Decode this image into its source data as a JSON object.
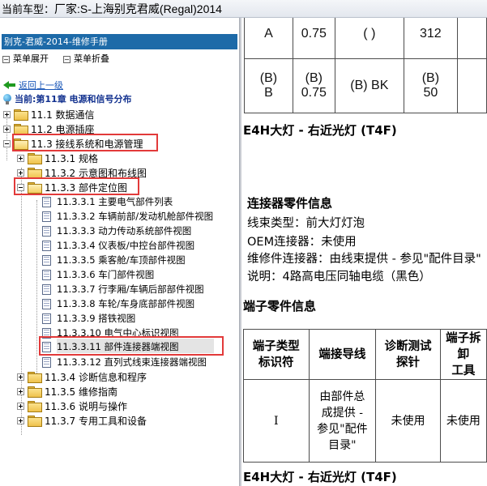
{
  "title_bar": {
    "label": "当前车型：",
    "value": "厂家:S-上海别克君威(Regal)2014"
  },
  "left_pane": {
    "header": "别克-君威-2014-维修手册",
    "toolbar": {
      "expand_label": "菜单展开",
      "collapse_label": "菜单折叠"
    },
    "back_link": "返回上一级",
    "current_chapter": "当前:第11章 电源和信号分布",
    "tree": [
      {
        "label": "11.1 数据通信",
        "level": 0,
        "expanded": false
      },
      {
        "label": "11.2 电源插座",
        "level": 0,
        "expanded": false
      },
      {
        "label": "11.3 接线系统和电源管理",
        "level": 0,
        "expanded": true,
        "highlighted": true
      },
      {
        "label": "11.3.1 规格",
        "level": 1,
        "expanded": false
      },
      {
        "label": "11.3.2 示意图和布线图",
        "level": 1,
        "expanded": false
      },
      {
        "label": "11.3.3 部件定位图",
        "level": 1,
        "expanded": true,
        "highlighted": true
      },
      {
        "label": "11.3.3.1 主要电气部件列表",
        "level": 2
      },
      {
        "label": "11.3.3.2 车辆前部/发动机舱部件视图",
        "level": 2
      },
      {
        "label": "11.3.3.3 动力传动系统部件视图",
        "level": 2
      },
      {
        "label": "11.3.3.4 仪表板/中控台部件视图",
        "level": 2
      },
      {
        "label": "11.3.3.5 乘客舱/车顶部件视图",
        "level": 2
      },
      {
        "label": "11.3.3.6 车门部件视图",
        "level": 2
      },
      {
        "label": "11.3.3.7 行李厢/车辆后部部件视图",
        "level": 2
      },
      {
        "label": "11.3.3.8 车轮/车身底部部件视图",
        "level": 2
      },
      {
        "label": "11.3.3.9 搭铁视图",
        "level": 2
      },
      {
        "label": "11.3.3.10 电气中心标识视图",
        "level": 2
      },
      {
        "label": "11.3.3.11 部件连接器端视图",
        "level": 2,
        "selected": true,
        "highlighted": true
      },
      {
        "label": "11.3.3.12 直列式线束连接器端视图",
        "level": 2
      },
      {
        "label": "11.3.4 诊断信息和程序",
        "level": 1,
        "expanded": false
      },
      {
        "label": "11.3.5 维修指南",
        "level": 1,
        "expanded": false
      },
      {
        "label": "11.3.6 说明与操作",
        "level": 1,
        "expanded": false
      },
      {
        "label": "11.3.7 专用工具和设备",
        "level": 1,
        "expanded": false
      }
    ]
  },
  "right_pane": {
    "top_table": {
      "rows": [
        [
          "A",
          "0.75",
          "(  )",
          "312"
        ],
        [
          "(B)\nB",
          "(B)\n0.75",
          "(B) BK",
          "(B)\n50"
        ]
      ]
    },
    "heading_1": "E4H大灯 - 右近光灯 (T4F)",
    "connector_heading": "连接器零件信息",
    "connector_info": [
      "线束类型：前大灯灯泡",
      "OEM连接器：未使用",
      "维修件连接器：由线束提供 - 参见\"配件目录\"",
      "说明：4路高电压同轴电缆（黑色）"
    ],
    "terminal_heading": "端子零件信息",
    "terminal_table": {
      "headers": [
        "端子类型\n标识符",
        "端接导线",
        "诊断测试\n探针",
        "端子拆卸\n工具"
      ],
      "rows": [
        [
          "I",
          "由部件总\n成提供 -\n参见\"配件\n目录\"",
          "未使用",
          "未使用"
        ]
      ]
    },
    "heading_2": "E4H大灯 - 右近光灯 (T4F)"
  },
  "colors": {
    "header_bg": "#1d6aa8",
    "highlight_border": "#e23a3a",
    "link_blue": "#1a57b8",
    "chapter_blue": "#12318f"
  }
}
